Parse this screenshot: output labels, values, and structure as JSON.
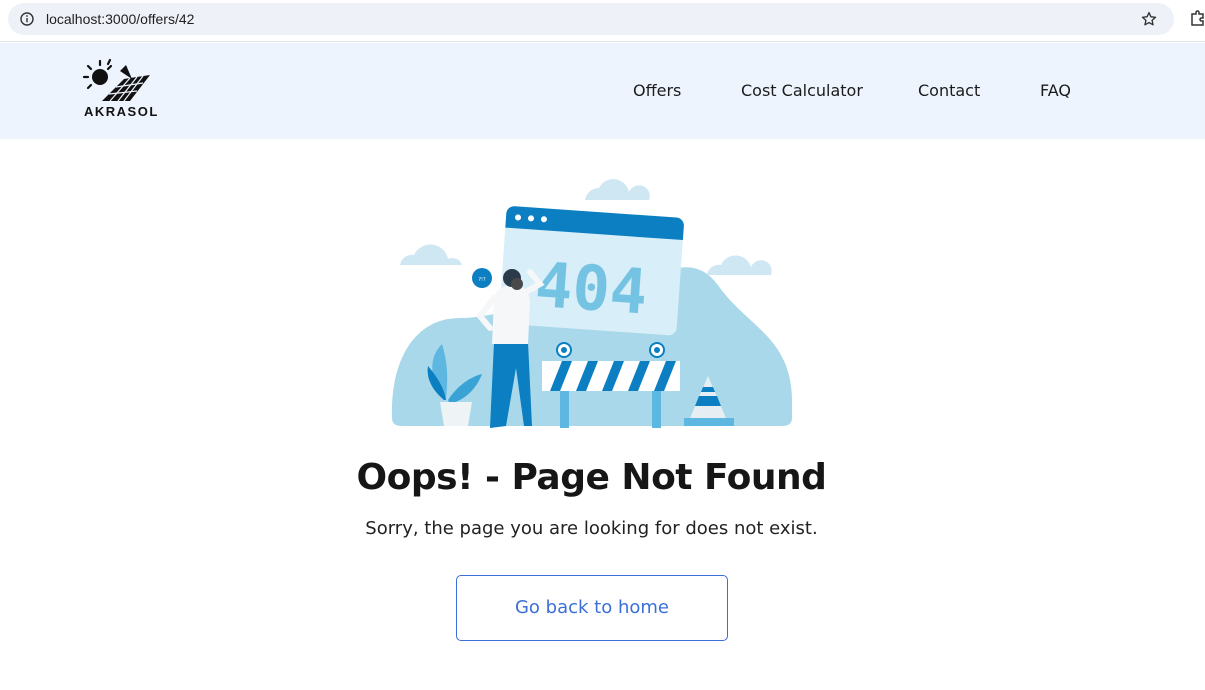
{
  "browser": {
    "url": "localhost:3000/offers/42",
    "site_info_icon": "info-circle-icon",
    "bookmark_icon": "star-icon",
    "extension_icon": "puzzle-icon"
  },
  "header": {
    "logo_text": "AKRASOL",
    "nav": [
      {
        "label": "Offers"
      },
      {
        "label": "Cost Calculator"
      },
      {
        "label": "Contact"
      },
      {
        "label": "FAQ"
      }
    ]
  },
  "illustration": {
    "error_code": "404",
    "icon": "404-illustration"
  },
  "main": {
    "title": "Oops! - Page Not Found",
    "subtitle": "Sorry, the page you are looking for does not exist.",
    "home_button_label": "Go back to home"
  },
  "colors": {
    "header_bg": "#eef4fd",
    "accent_blue": "#3b6fd8",
    "illustration_dark": "#0b7fc1",
    "illustration_light": "#a9d8ea"
  }
}
